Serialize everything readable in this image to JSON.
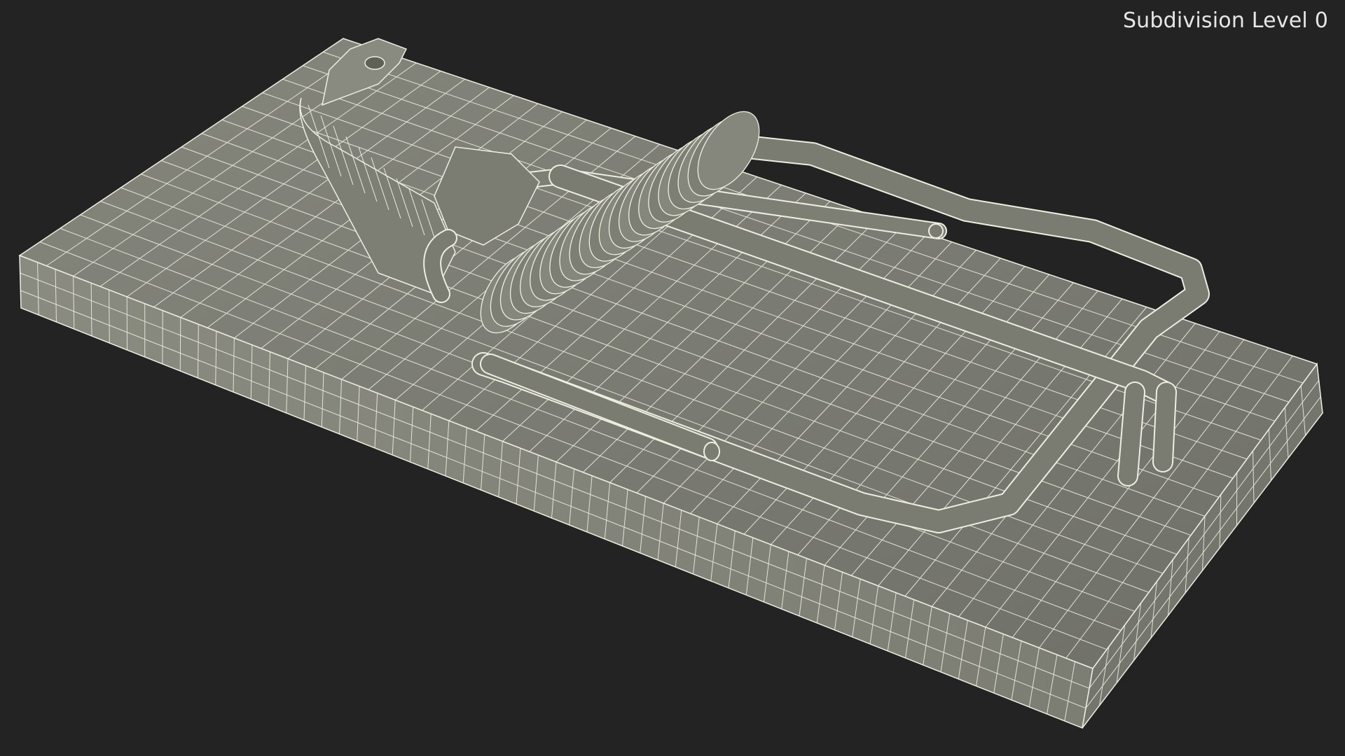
{
  "viewport": {
    "overlay_label": "Subdivision Level 0",
    "background_color": "#232323",
    "mesh_fill_color": "#7b7c72",
    "wire_color": "#eeeee0"
  },
  "subject": {
    "icon": "mousetrap-wireframe-model"
  }
}
